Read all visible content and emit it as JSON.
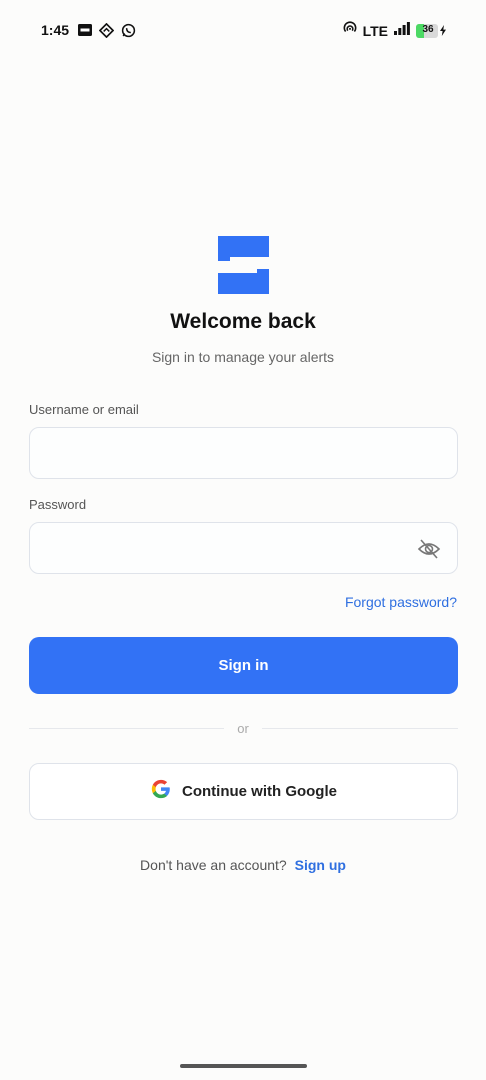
{
  "status_bar": {
    "time": "1:45",
    "network": "LTE",
    "battery": "36",
    "battery_level": 0.36,
    "icons": [
      "app-notification-icon",
      "location-diamond-icon",
      "whatsapp-icon",
      "hotspot-icon",
      "signal-bars-icon",
      "battery-icon",
      "charging-bolt-icon"
    ]
  },
  "brand": {
    "logo_icon": "app-logo-icon",
    "accent": "#3272f5"
  },
  "header": {
    "title": "Welcome back",
    "subtitle": "Sign in to manage your alerts"
  },
  "form": {
    "username_label": "Username or email",
    "username_value": "",
    "username_placeholder": "",
    "password_label": "Password",
    "password_value": "",
    "password_placeholder": "",
    "password_toggle_icon": "eye-off-icon",
    "forgot_password": "Forgot password?",
    "sign_in": "Sign in"
  },
  "divider": {
    "text": "or"
  },
  "google": {
    "label": "Continue with Google",
    "icon": "google-icon"
  },
  "footer": {
    "prompt": "Don't have an account?",
    "signup_link": "Sign up"
  }
}
